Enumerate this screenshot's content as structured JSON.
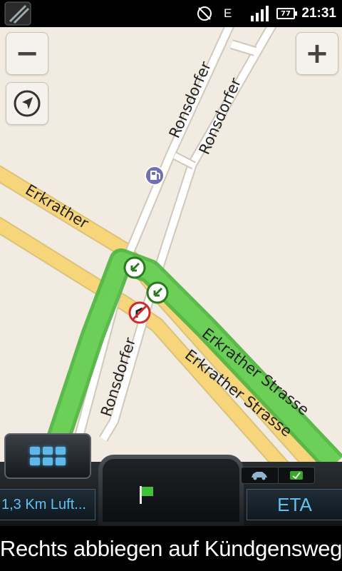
{
  "status_bar": {
    "time": "21:31",
    "battery": "77",
    "network": "E",
    "icons": [
      "navigation-app-icon",
      "gps-icon",
      "edge-network-icon",
      "signal-icon",
      "battery-icon"
    ]
  },
  "map": {
    "streets": {
      "ronsdorfer_top_left": "Ronsdorfer",
      "ronsdorfer_top_right": "Ronsdorfer",
      "ronsdorfer_bottom": "Ronsdorfer",
      "erkrather": "Erkrather",
      "erkrather_strasse_route": "Erkrather Strasse",
      "erkrather_strasse_yellow": "Erkrather Strasse"
    },
    "poi_icons": [
      "fuel-station-icon"
    ],
    "traffic_signs": [
      "turn-left-allowed-icon",
      "turn-left-allowed-icon",
      "no-turn-icon"
    ],
    "route_color": "#5cc54a",
    "main_road_color": "#f7d57a"
  },
  "controls": {
    "zoom_out": "−",
    "zoom_in": "+",
    "locate_icon": "compass-arrow-icon"
  },
  "dashboard": {
    "menu_icon": "grid-menu-icon",
    "destination_icon": "flag-icon",
    "distance": "1,3 Km Luft...",
    "eta": "ETA",
    "mode_icons": [
      "car-icon",
      "traffic-icon"
    ]
  },
  "instruction": {
    "text": "Rechts abbiegen auf Kündgensweg"
  }
}
